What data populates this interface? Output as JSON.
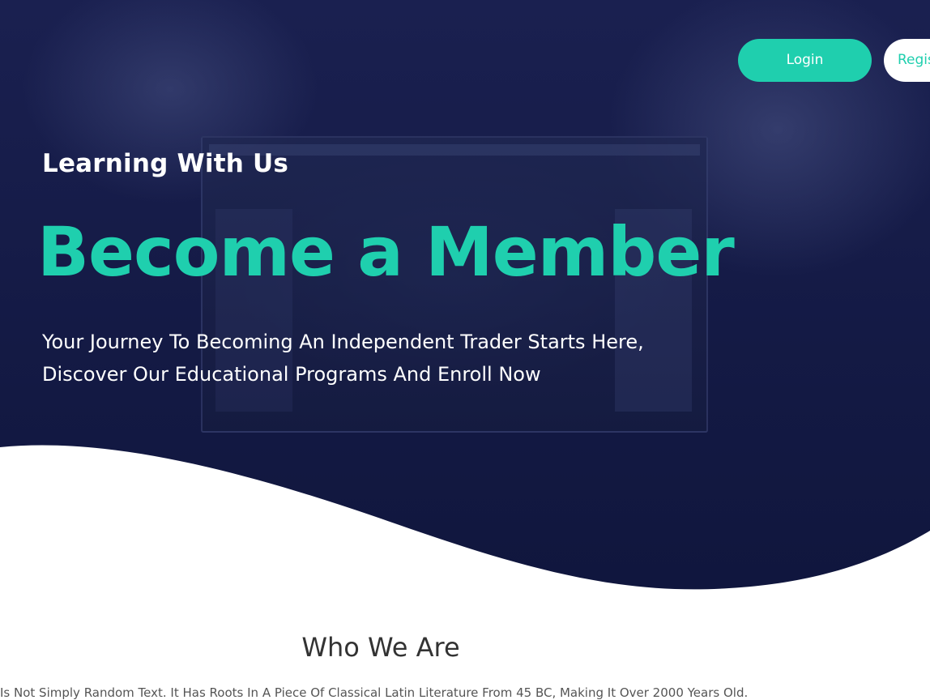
{
  "header": {
    "login_label": "Login",
    "register_label": "Register"
  },
  "hero": {
    "eyebrow": "Learning With Us",
    "headline": "Become a Member",
    "subtitle": "Your Journey To Becoming An Independent Trader Starts Here, Discover Our Educational Programs And Enroll Now"
  },
  "about": {
    "title": "Who We Are",
    "text": "Is Not Simply Random Text. It Has Roots In A Piece Of Classical Latin Literature From 45 BC, Making It Over 2000 Years Old."
  },
  "colors": {
    "accent": "#1fcfae",
    "hero_background": "#141a45",
    "text_white": "#ffffff",
    "heading_dark": "#333333"
  },
  "icons": {
    "hero_background": "hero-background-image"
  }
}
